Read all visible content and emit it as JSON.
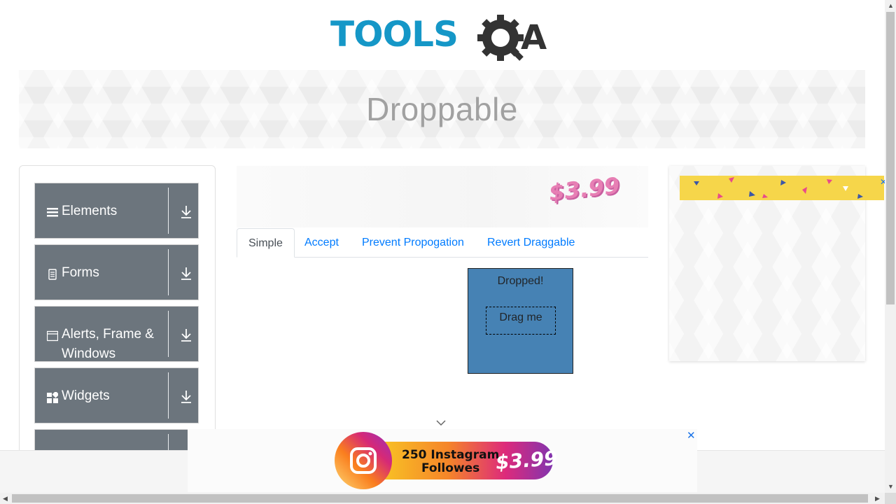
{
  "header": {
    "logo_text": "TOOLSQA"
  },
  "banner": {
    "title": "Droppable"
  },
  "sidebar": {
    "groups": [
      {
        "label": "Elements",
        "icon": "list-icon"
      },
      {
        "label": "Forms",
        "icon": "document-icon"
      },
      {
        "label": "Alerts, Frame &",
        "label_line2": "Windows",
        "icon": "window-icon"
      },
      {
        "label": "Widgets",
        "icon": "grid-icon"
      },
      {
        "label": "",
        "icon": ""
      }
    ]
  },
  "ad_top": {
    "price": "$3.99"
  },
  "tabs": [
    {
      "label": "Simple",
      "active": true
    },
    {
      "label": "Accept",
      "active": false
    },
    {
      "label": "Prevent Propogation",
      "active": false
    },
    {
      "label": "Revert Draggable",
      "active": false
    }
  ],
  "droppable": {
    "text": "Dropped!",
    "drag_text": "Drag me",
    "color": "#4682b4"
  },
  "ad_bottom": {
    "line1": "250 Instagram",
    "line2": "Followes",
    "price": "$3.99",
    "close": "✕"
  },
  "ad_right": {
    "close": "✕"
  },
  "colors": {
    "accent": "#007bff",
    "nav_bg": "#6c757d",
    "logo_blue": "#1597c7",
    "logo_dark": "#333333"
  }
}
